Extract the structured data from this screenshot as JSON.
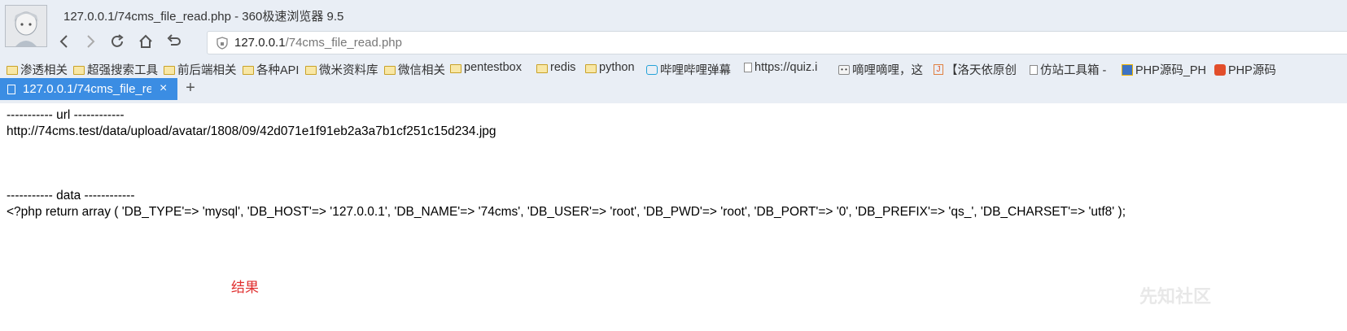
{
  "window": {
    "title": "127.0.0.1/74cms_file_read.php - 360极速浏览器 9.5"
  },
  "urlbar": {
    "host": "127.0.0.1",
    "path": "/74cms_file_read.php",
    "right_glyph": "⚡"
  },
  "bookmarks": [
    {
      "label": "渗透相关",
      "icon": "folder-icon"
    },
    {
      "label": "超强搜索工具",
      "icon": "folder-icon"
    },
    {
      "label": "前后端相关",
      "icon": "folder-icon"
    },
    {
      "label": "各种API",
      "icon": "folder-icon"
    },
    {
      "label": "微米资料库",
      "icon": "folder-icon"
    },
    {
      "label": "微信相关",
      "icon": "folder-icon"
    },
    {
      "label": "pentestbox",
      "icon": "folder-icon"
    },
    {
      "label": "redis",
      "icon": "folder-icon"
    },
    {
      "label": "python",
      "icon": "folder-icon"
    },
    {
      "label": "哔哩哔哩弹幕",
      "icon": "bilibili-icon"
    },
    {
      "label": "https://quiz.i",
      "icon": "page-icon"
    },
    {
      "label": "嘀哩嘀哩，这",
      "icon": "face-icon"
    },
    {
      "label": "【洛天依原创",
      "icon": "j-icon"
    },
    {
      "label": "仿站工具箱 -",
      "icon": "page-icon"
    },
    {
      "label": "PHP源码_PH",
      "icon": "php-icon"
    },
    {
      "label": "PHP源码",
      "icon": "php2-icon"
    }
  ],
  "tab": {
    "title": "127.0.0.1/74cms_file_re",
    "close": "×",
    "new_tab": "+"
  },
  "content": {
    "url_header": "----------- url ------------",
    "url_value": "http://74cms.test/data/upload/avatar/1808/09/42d071e1f91eb2a3a7b1cf251c15d234.jpg",
    "data_header": "----------- data ------------",
    "data_value": "<?php return array ( 'DB_TYPE'=> 'mysql', 'DB_HOST'=> '127.0.0.1', 'DB_NAME'=> '74cms', 'DB_USER'=> 'root', 'DB_PWD'=> 'root', 'DB_PORT'=> '0', 'DB_PREFIX'=> 'qs_', 'DB_CHARSET'=> 'utf8' );",
    "result_label": "结果"
  },
  "watermark": "先知社区",
  "colors": {
    "chrome_bg": "#e9eef5",
    "tab_active": "#3b8de3",
    "result_red": "#e03030"
  }
}
